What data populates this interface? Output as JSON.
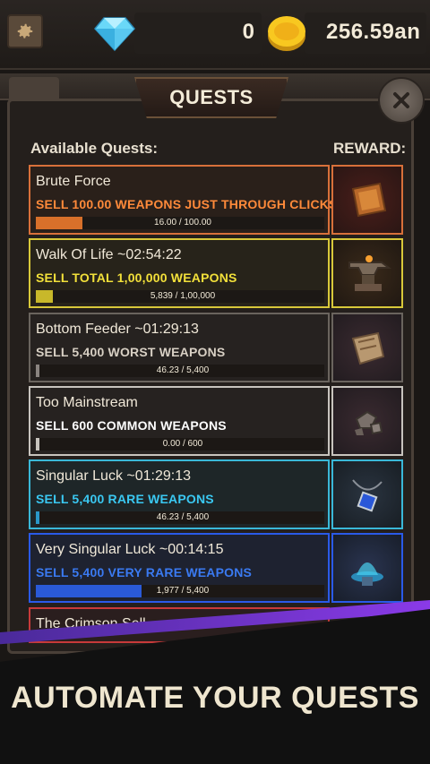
{
  "header": {
    "gem_count": "0",
    "coin_count": "256.59an",
    "settings_icon": "gear-icon",
    "gem_icon": "diamond-icon",
    "coin_icon": "coin-icon"
  },
  "panel": {
    "title": "QUESTS",
    "close_icon": "close-icon",
    "available_label": "Available Quests:",
    "reward_label": "REWARD:"
  },
  "quests": [
    {
      "name": "Brute Force",
      "desc": "SELL 100.00 WEAPONS JUST THROUGH CLICKS",
      "progress_text": "16.00 / 100.00",
      "progress": 0.16,
      "rarity_color": "#d8703a",
      "reward_icon": "leather-scrap-icon"
    },
    {
      "name": "Walk Of Life ~02:54:22",
      "desc": "SELL TOTAL 1,00,000 WEAPONS",
      "progress_text": "5,839 / 1,00,000",
      "progress": 0.058,
      "rarity_color": "#d8c83a",
      "reward_icon": "anvil-icon"
    },
    {
      "name": "Bottom Feeder ~01:29:13",
      "desc": "SELL 5,400 WORST WEAPONS",
      "progress_text": "46.23 / 5,400",
      "progress": 0.0086,
      "rarity_color": "#6a645e",
      "reward_icon": "parchment-icon"
    },
    {
      "name": "Too Mainstream",
      "desc": "SELL 600 COMMON WEAPONS",
      "progress_text": "0.00 / 600",
      "progress": 0.0,
      "rarity_color": "#c8c4be",
      "reward_icon": "ore-icon"
    },
    {
      "name": "Singular Luck ~01:29:13",
      "desc": "SELL 5,400 RARE WEAPONS",
      "progress_text": "46.23 / 5,400",
      "progress": 0.0086,
      "rarity_color": "#3ab8d8",
      "reward_icon": "amulet-icon"
    },
    {
      "name": "Very Singular Luck ~00:14:15",
      "desc": "SELL 5,400 VERY RARE WEAPONS",
      "progress_text": "1,977 / 5,400",
      "progress": 0.366,
      "rarity_color": "#2a5ae8",
      "reward_icon": "magic-pedestal-icon"
    },
    {
      "name": "The Crimson Sell"
    }
  ],
  "promo": {
    "text": "AUTOMATE YOUR QUESTS"
  }
}
